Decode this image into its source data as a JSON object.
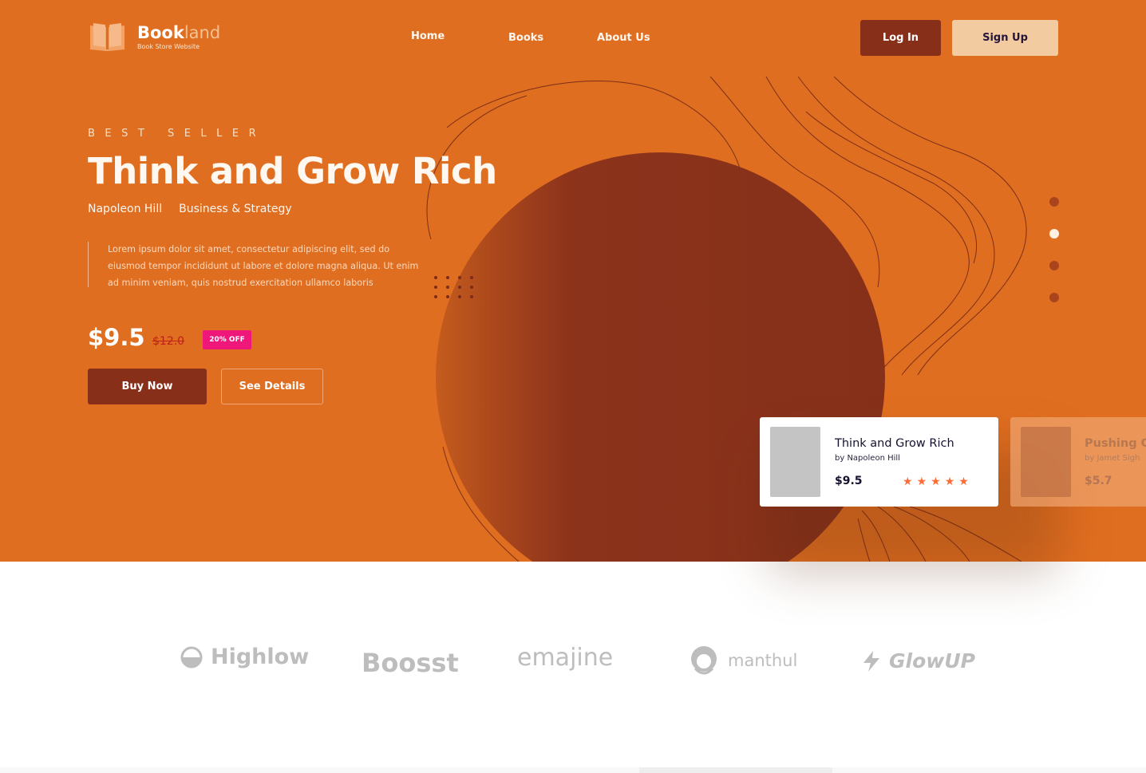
{
  "brand": {
    "name_bold": "Book",
    "name_light": "land",
    "tagline": "Book Store Website",
    "icon": "open-book-icon"
  },
  "nav": {
    "items": [
      {
        "label": "Home"
      },
      {
        "label": "Books"
      },
      {
        "label": "About Us"
      }
    ]
  },
  "auth": {
    "login_label": "Log In",
    "signup_label": "Sign Up"
  },
  "hero": {
    "eyebrow": "BEST SELLER",
    "title": "Think and Grow Rich",
    "author": "Napoleon Hill",
    "category": "Business & Strategy",
    "description": "Lorem ipsum dolor sit amet, consectetur adipiscing elit, sed do eiusmod tempor incididunt ut labore et dolore magna aliqua. Ut enim ad minim veniam, quis nostrud exercitation ullamco laboris",
    "price": "$9.5",
    "old_price": "$12.0",
    "discount": "20% OFF",
    "buy_label": "Buy Now",
    "details_label": "See Details",
    "slide_active_index": 1,
    "slide_count": 4
  },
  "cards": [
    {
      "title": "Think and Grow Rich",
      "author": "by Napoleon Hill",
      "price": "$9.5",
      "rating": 5
    },
    {
      "title": "Pushing C",
      "author": "by Jamet Sigh",
      "price": "$5.7"
    }
  ],
  "partners": [
    {
      "name": "Highlow",
      "icon": "half-circle-icon"
    },
    {
      "name": "Boosst"
    },
    {
      "name": "emajine"
    },
    {
      "name": "manthul",
      "icon": "person-smile-icon"
    },
    {
      "name": "GlowUP",
      "icon": "lightning-icon"
    }
  ],
  "colors": {
    "hero_bg": "#e06e20",
    "dark_accent": "#882f1a",
    "signup_bg": "#f3cba0",
    "discount_badge": "#f0177a",
    "star": "#ff6b34"
  }
}
